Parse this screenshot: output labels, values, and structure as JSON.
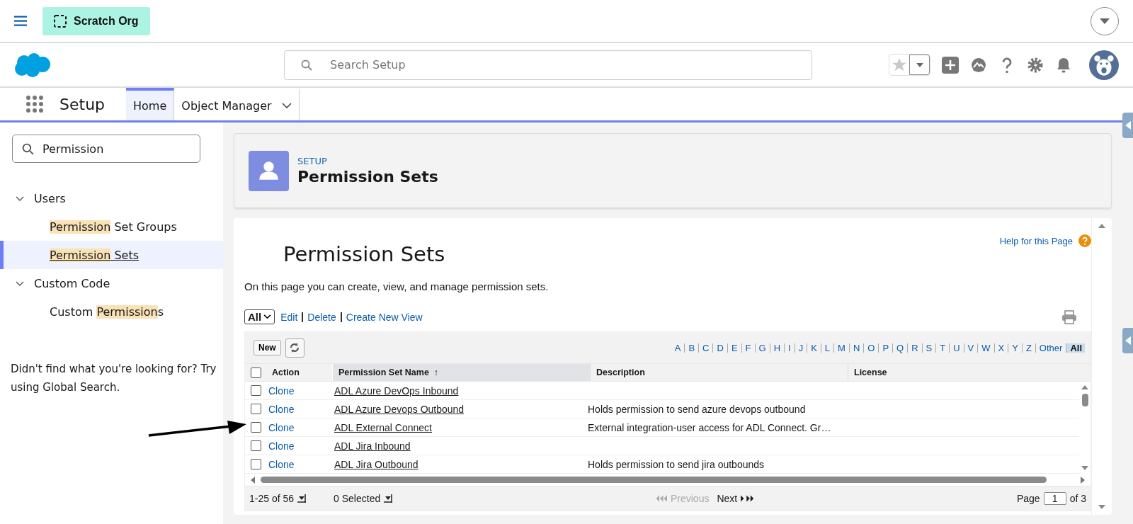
{
  "top_bar": {
    "org_badge": "Scratch Org"
  },
  "header": {
    "search": {
      "placeholder": "Search Setup"
    }
  },
  "nav": {
    "app_name": "Setup",
    "tabs": [
      {
        "label": "Home",
        "selected": true,
        "dropdown": false
      },
      {
        "label": "Object Manager",
        "selected": false,
        "dropdown": true
      }
    ]
  },
  "sidebar": {
    "search": {
      "value": "Permission"
    },
    "groups": [
      {
        "label": "Users",
        "expanded": true,
        "children": [
          {
            "parts": [
              {
                "text": "Permission",
                "highlighted": true
              },
              {
                "text": " Set Groups",
                "highlighted": false
              }
            ],
            "selected": false
          },
          {
            "parts": [
              {
                "text": "Permission",
                "highlighted": true
              },
              {
                "text": " Sets",
                "highlighted": false
              }
            ],
            "selected": true
          }
        ]
      },
      {
        "label": "Custom Code",
        "expanded": true,
        "children": [
          {
            "parts": [
              {
                "text": "Custom ",
                "highlighted": false
              },
              {
                "text": "Permission",
                "highlighted": true
              },
              {
                "text": "s",
                "highlighted": false
              }
            ],
            "selected": false
          }
        ]
      }
    ],
    "help_text": "Didn't find what you're looking for? Try using Global Search."
  },
  "page_header": {
    "eyebrow": "SETUP",
    "title": "Permission Sets"
  },
  "content": {
    "title": "Permission Sets",
    "help_link": "Help for this Page",
    "description": "On this page you can create, view, and manage permission sets.",
    "view_select": "All",
    "view_links": [
      "Edit",
      "Delete",
      "Create New View"
    ],
    "new_button": "New",
    "letters": [
      {
        "label": "A",
        "selected": false
      },
      {
        "label": "B",
        "selected": false
      },
      {
        "label": "C",
        "selected": false
      },
      {
        "label": "D",
        "selected": false
      },
      {
        "label": "E",
        "selected": false
      },
      {
        "label": "F",
        "selected": false
      },
      {
        "label": "G",
        "selected": false
      },
      {
        "label": "H",
        "selected": false
      },
      {
        "label": "I",
        "selected": false
      },
      {
        "label": "J",
        "selected": false
      },
      {
        "label": "K",
        "selected": false
      },
      {
        "label": "L",
        "selected": false
      },
      {
        "label": "M",
        "selected": false
      },
      {
        "label": "N",
        "selected": false
      },
      {
        "label": "O",
        "selected": false
      },
      {
        "label": "P",
        "selected": false
      },
      {
        "label": "Q",
        "selected": false
      },
      {
        "label": "R",
        "selected": false
      },
      {
        "label": "S",
        "selected": false
      },
      {
        "label": "T",
        "selected": false
      },
      {
        "label": "U",
        "selected": false
      },
      {
        "label": "V",
        "selected": false
      },
      {
        "label": "W",
        "selected": false
      },
      {
        "label": "X",
        "selected": false
      },
      {
        "label": "Y",
        "selected": false
      },
      {
        "label": "Z",
        "selected": false
      },
      {
        "label": "Other",
        "selected": false
      },
      {
        "label": "All",
        "selected": true
      }
    ],
    "table": {
      "select_all_checked": false,
      "columns": [
        "Action",
        "Permission Set Name",
        "Description",
        "License"
      ],
      "sort_indicator": "↑",
      "rows": [
        {
          "checked": false,
          "action": "Clone",
          "name": "ADL Azure DevOps Inbound"
        },
        {
          "checked": false,
          "action": "Clone",
          "name": "ADL Azure Devops Outbound",
          "description": "Holds permission to send azure devops outbound"
        },
        {
          "checked": false,
          "action": "Clone",
          "name": "ADL External Connect",
          "description": "External integration-user access for ADL Connect. Gr…"
        },
        {
          "checked": false,
          "action": "Clone",
          "name": "ADL Jira Inbound"
        },
        {
          "checked": false,
          "action": "Clone",
          "name": "ADL Jira Outbound",
          "description": "Holds permission to send jira outbounds"
        }
      ]
    },
    "footer": {
      "range": "1-25 of 56",
      "selected": "0 Selected",
      "previous": "Previous",
      "next": "Next",
      "page_label": "Page",
      "page_value": "1",
      "page_total": "of 3"
    }
  },
  "annotations": [
    {
      "kind": "arrow"
    }
  ]
}
